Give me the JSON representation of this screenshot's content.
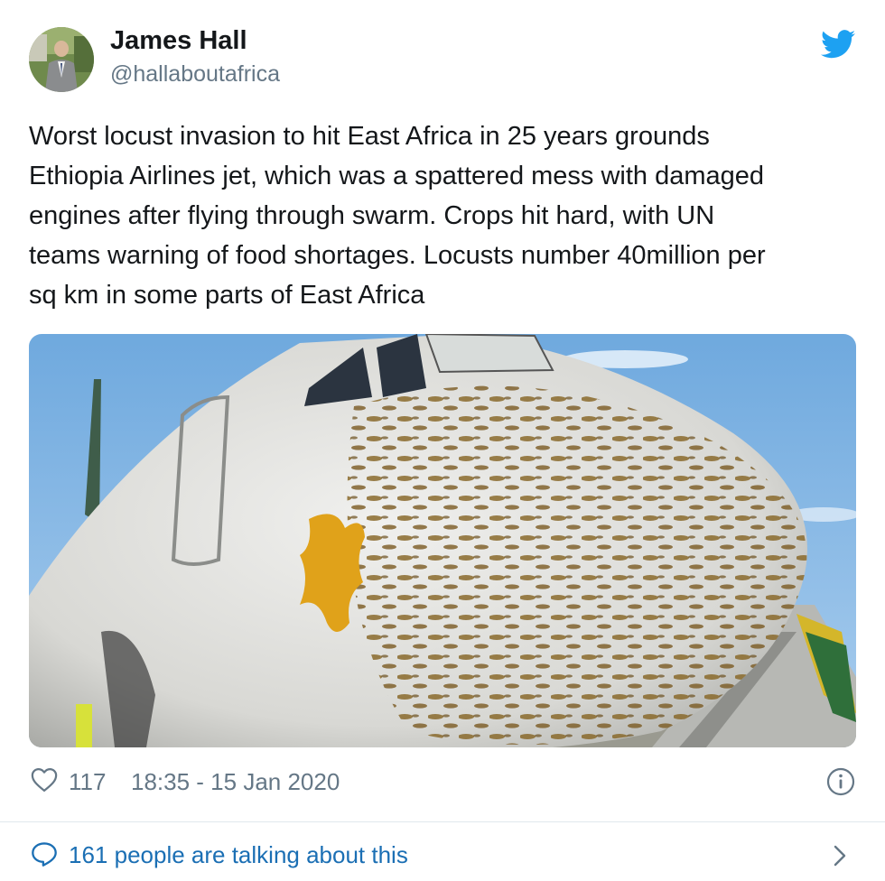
{
  "author": {
    "name": "James Hall",
    "handle": "@hallaboutafrica"
  },
  "icons": {
    "brand": "twitter-bird-icon",
    "like": "heart-icon",
    "info": "info-icon",
    "reply": "speech-bubble-icon",
    "more": "chevron-right-icon"
  },
  "tweet": {
    "text": "Worst locust invasion to hit East Africa in 25 years grounds\nEthiopia Airlines jet, which was a spattered mess with damaged\nengines after flying through swarm. Crops hit hard, with UN\nteams warning of food shortages. Locusts number 40million per\nsq km in some parts of East Africa",
    "like_count": "117",
    "timestamp": "18:35 - 15 Jan 2020"
  },
  "conversation": {
    "label": "161 people are talking about this"
  },
  "colors": {
    "brand_blue": "#1da1f2",
    "link_blue": "#1b6fb4",
    "secondary_text": "#657786",
    "primary_text": "#14171a",
    "divider": "#e1e8ed"
  }
}
